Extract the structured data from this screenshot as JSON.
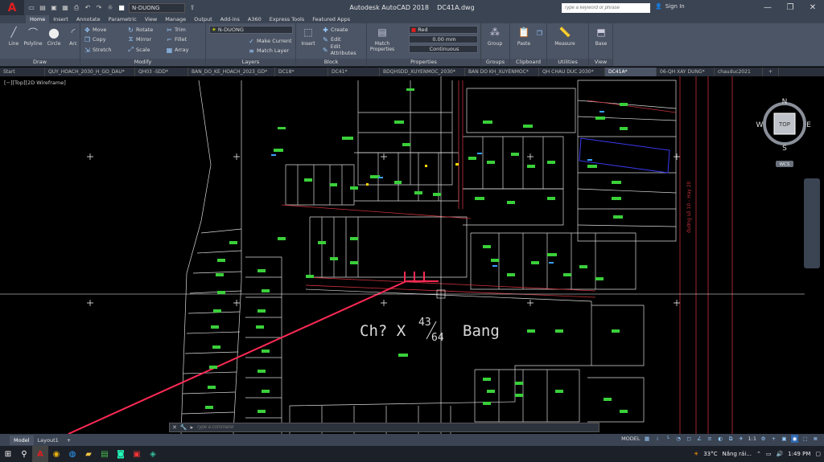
{
  "title_bar": {
    "app_logo": "A",
    "app_name": "Autodesk AutoCAD 2018",
    "doc_name": "DC41A.dwg",
    "layer_combo": "N-DUONG",
    "search_placeholder": "Type a keyword or phrase",
    "sign_in": "Sign In",
    "icons": [
      "new-icon",
      "open-icon",
      "save-icon",
      "saveas-icon",
      "plot-icon",
      "undo-icon",
      "redo-icon",
      "share-icon"
    ]
  },
  "ribbon_tabs": [
    "Home",
    "Insert",
    "Annotate",
    "Parametric",
    "View",
    "Manage",
    "Output",
    "Add-ins",
    "A360",
    "Express Tools",
    "Featured Apps"
  ],
  "ribbon": {
    "draw": {
      "title": "Draw",
      "line": "Line",
      "polyline": "Polyline",
      "circle": "Circle",
      "arc": "Arc"
    },
    "modify": {
      "title": "Modify",
      "move": "Move",
      "rotate": "Rotate",
      "trim": "Trim",
      "copy": "Copy",
      "mirror": "Mirror",
      "fillet": "Fillet",
      "stretch": "Stretch",
      "scale": "Scale",
      "array": "Array"
    },
    "layers": {
      "title": "Layers",
      "layer_name": "N-DUONG",
      "make_current": "Make Current",
      "match_layer": "Match Layer"
    },
    "block": {
      "title": "Block",
      "insert": "Insert",
      "create": "Create",
      "edit": "Edit",
      "edit_attributes": "Edit Attributes"
    },
    "properties": {
      "title": "Properties",
      "match_properties": "Match Properties",
      "color": "Red",
      "lineweight": "0.00 mm",
      "linetype": "Continuous"
    },
    "groups": {
      "title": "Groups",
      "group": "Group"
    },
    "clipboard": {
      "title": "Clipboard",
      "paste": "Paste"
    },
    "utilities": {
      "title": "Utilities",
      "measure": "Measure"
    },
    "view": {
      "title": "View",
      "base": "Base"
    }
  },
  "doc_tabs": [
    "Start",
    "QUY_HOACH_2030_H_GO_DAU*",
    "QH03 -SDD*",
    "BAN_DO_KE_HOACH_2023_GD*",
    "DC18*",
    "DC41*",
    "BDQHSDD_XUYENMOC_2030*",
    "BAN DO KH_XUYENMOC*",
    "QH CHAU DUC 2030*",
    "DC41A*",
    "06-QH XAY DUNG*",
    "chauduc2021"
  ],
  "active_doc_tab": "DC41A*",
  "viewport_label": "[−][Top][2D Wireframe]",
  "drawing": {
    "main_label": "Ch? X",
    "fraction_num": "43",
    "fraction_den": "64",
    "main_label_suffix": "Bang",
    "road_label": "đường số 10 - Hay 20",
    "colors": {
      "parcel": "#d9d9d9",
      "road": "#c8323c",
      "selection": "#3a3af0",
      "highlight": "#ff2a55",
      "labels": "#3ad03a"
    }
  },
  "view_cube": {
    "n": "N",
    "s": "S",
    "e": "E",
    "w": "W",
    "top": "TOP",
    "wcs": "WCS"
  },
  "command_line": {
    "placeholder": "Type a command"
  },
  "layout_tabs": [
    "Model",
    "Layout1"
  ],
  "status": {
    "mode": "MODEL",
    "scale": "1:1"
  },
  "taskbar": {
    "weather": "33°C",
    "weather_text": "Nắng rái...",
    "time": "1:49 PM"
  }
}
